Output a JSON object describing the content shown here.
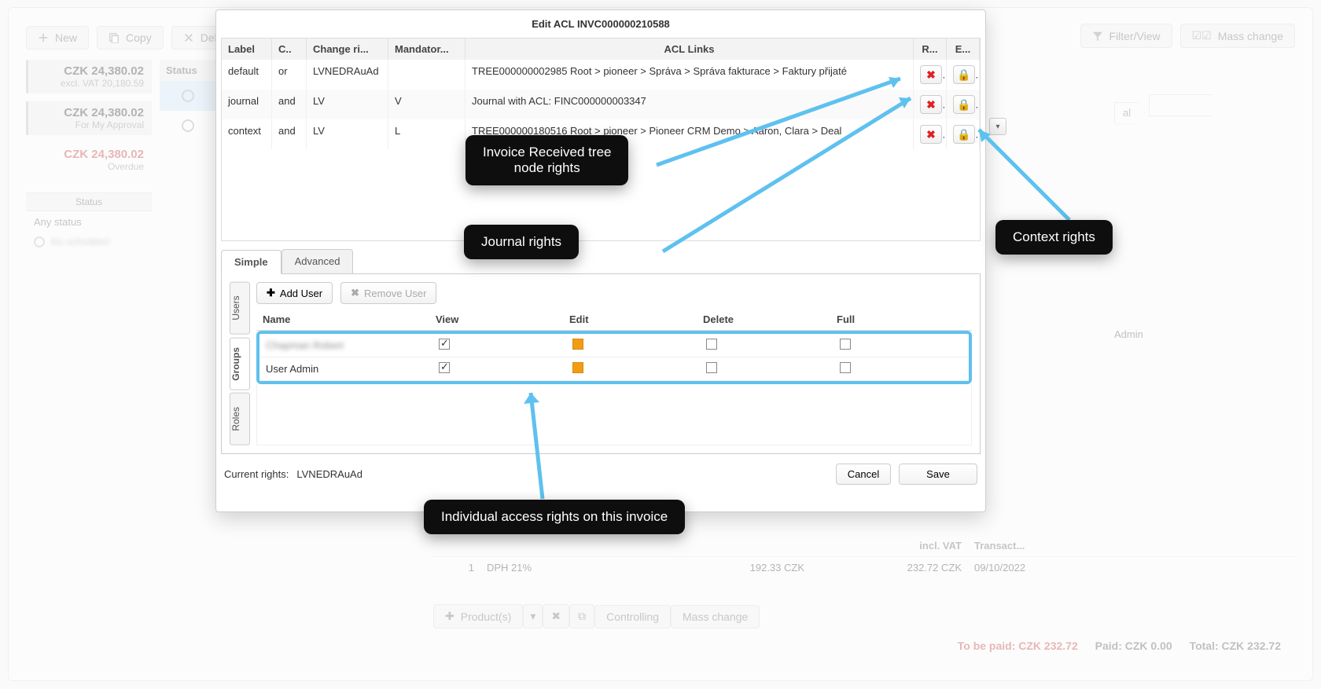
{
  "toolbar": {
    "new": "New",
    "copy": "Copy",
    "delete": "Del...",
    "filter": "Filter/View",
    "mass": "Mass change"
  },
  "left": {
    "items": [
      {
        "amount": "CZK 24,380.02",
        "sub": "excl. VAT 20,180.59"
      },
      {
        "amount": "CZK 24,380.02",
        "sub": "For My Approval"
      },
      {
        "amount": "CZK 24,380.02",
        "sub": "Overdue",
        "red": true
      }
    ],
    "status_header": "Status",
    "any_status": "Any status",
    "hidden_option": "Ke schválení"
  },
  "status_col": {
    "header": "Status"
  },
  "right": {
    "crumb": "al",
    "owner": "Admin"
  },
  "bottom_table": {
    "headers": {
      "incl": "incl. VAT",
      "trans": "Transact..."
    },
    "row": {
      "qty": "1",
      "tax": "DPH 21%",
      "amt": "192.33 CZK",
      "incl": "232.72 CZK",
      "date": "09/10/2022"
    }
  },
  "bottom_bar": {
    "products": "Product(s)",
    "controlling": "Controlling",
    "mass": "Mass change"
  },
  "totals": {
    "to_be_paid": "To be paid: CZK 232.72",
    "paid": "Paid: CZK 0.00",
    "total": "Total: CZK 232.72"
  },
  "modal": {
    "title": "Edit ACL INVC000000210588",
    "headers": {
      "label": "Label",
      "c": "C..",
      "cr": "Change ri...",
      "m": "Mandator...",
      "links": "ACL Links",
      "r": "R...",
      "e": "E..."
    },
    "rows": [
      {
        "label": "default",
        "c": "or",
        "cr": "LVNEDRAuAd",
        "m": "",
        "links": "TREE000000002985 Root > pioneer > Správa > Správa fakturace > Faktury přijaté"
      },
      {
        "label": "journal",
        "c": "and",
        "cr": "LV",
        "m": "V",
        "links": "Journal with ACL: FINC000000003347"
      },
      {
        "label": "context",
        "c": "and",
        "cr": "LV",
        "m": "L",
        "links": "TREE000000180516 Root > pioneer > Pioneer CRM Demo > Aaron, Clara > Deal"
      }
    ],
    "tabs": {
      "simple": "Simple",
      "advanced": "Advanced"
    },
    "side_tabs": {
      "users": "Users",
      "groups": "Groups",
      "roles": "Roles"
    },
    "add_user": "Add User",
    "remove_user": "Remove User",
    "rights_headers": {
      "name": "Name",
      "view": "View",
      "edit": "Edit",
      "delete": "Delete",
      "full": "Full"
    },
    "rights_rows": [
      {
        "name": "Chapman Robert",
        "blur": true,
        "view": true,
        "edit": "partial",
        "delete": false,
        "full": false
      },
      {
        "name": "User Admin",
        "blur": false,
        "view": true,
        "edit": "partial",
        "delete": false,
        "full": false
      }
    ],
    "current_rights_label": "Current rights:",
    "current_rights_value": "LVNEDRAuAd",
    "cancel": "Cancel",
    "save": "Save"
  },
  "callouts": {
    "tree": "Invoice Received tree\nnode rights",
    "journal": "Journal rights",
    "context": "Context rights",
    "individual": "Individual access rights on this invoice"
  }
}
